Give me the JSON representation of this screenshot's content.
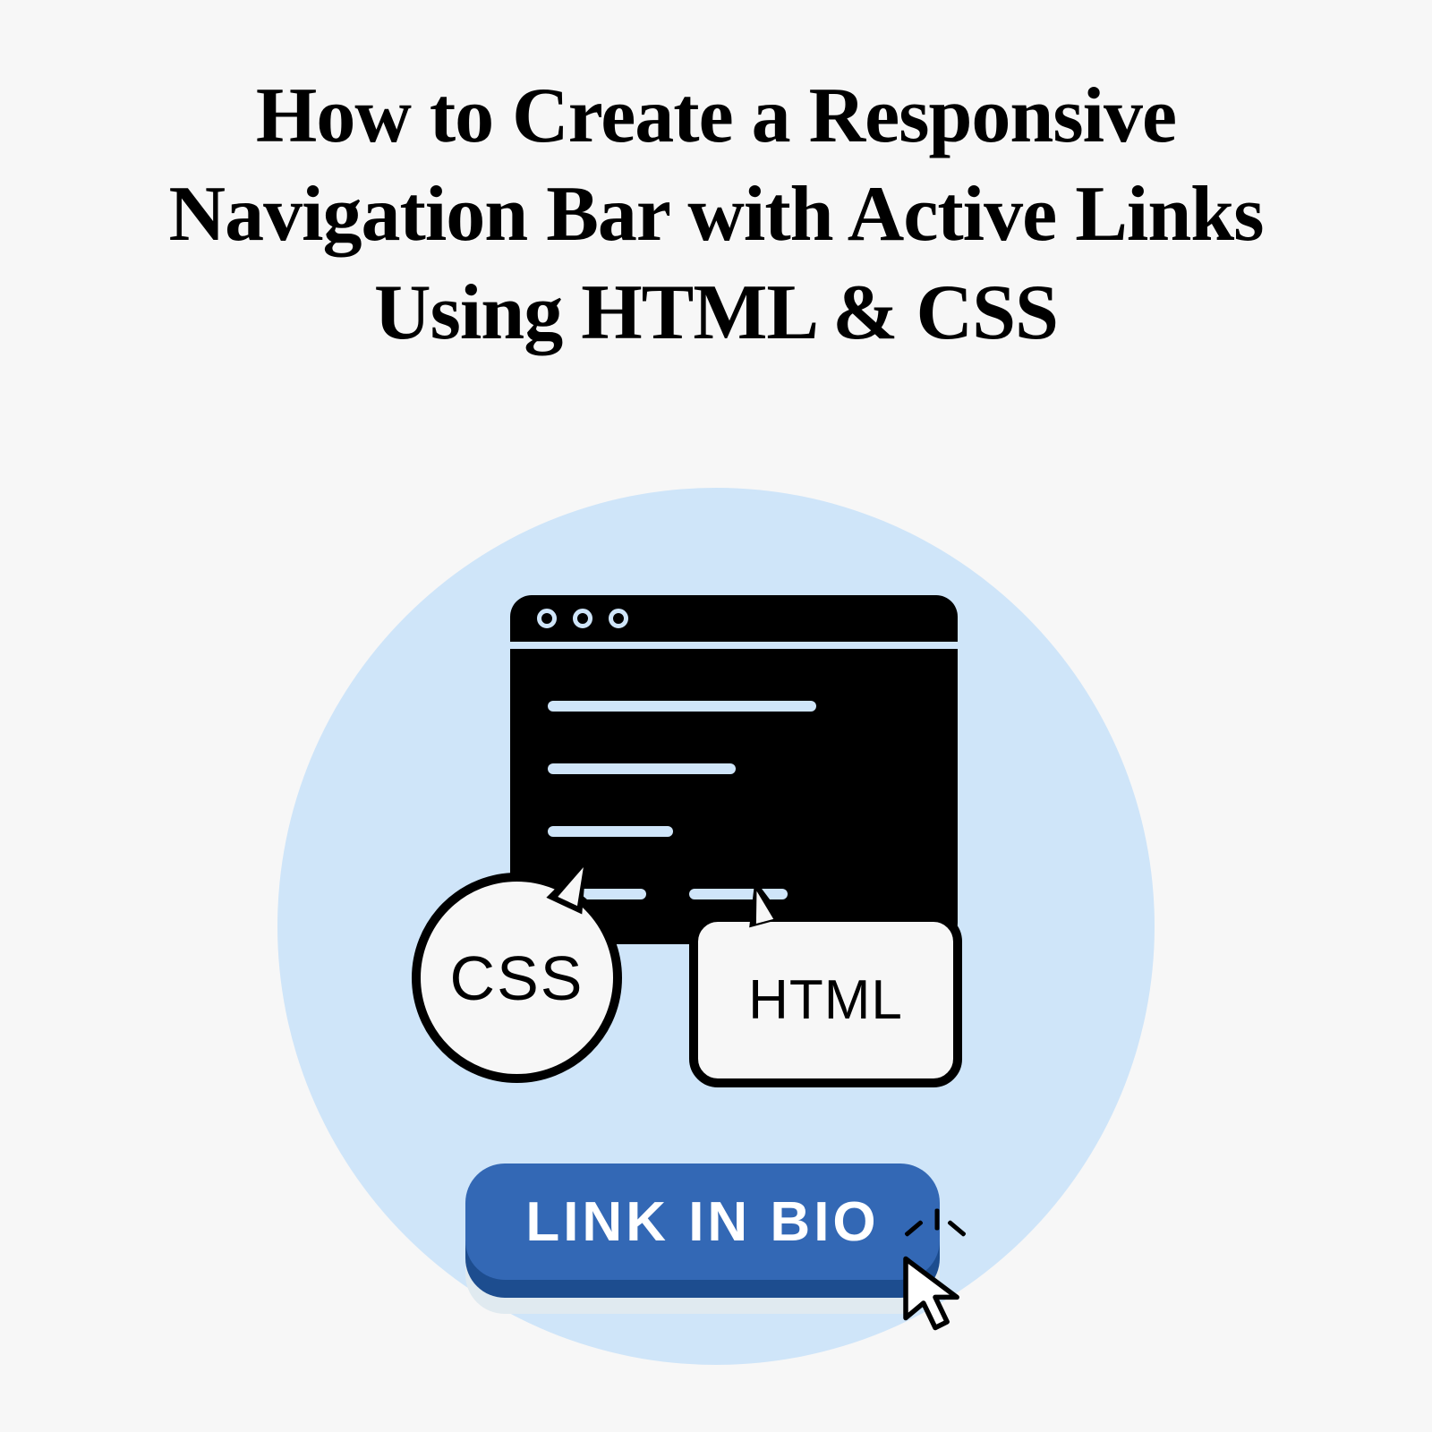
{
  "title": "How to Create a Responsive Navigation Bar with Active Links Using HTML & CSS",
  "bubbles": {
    "css_label": "CSS",
    "html_label": "HTML"
  },
  "button": {
    "label": "LINK IN BIO"
  },
  "colors": {
    "background": "#f7f7f7",
    "circle": "#cfe5f9",
    "button_primary": "#3368b5",
    "button_dark": "#1d4d8f"
  }
}
